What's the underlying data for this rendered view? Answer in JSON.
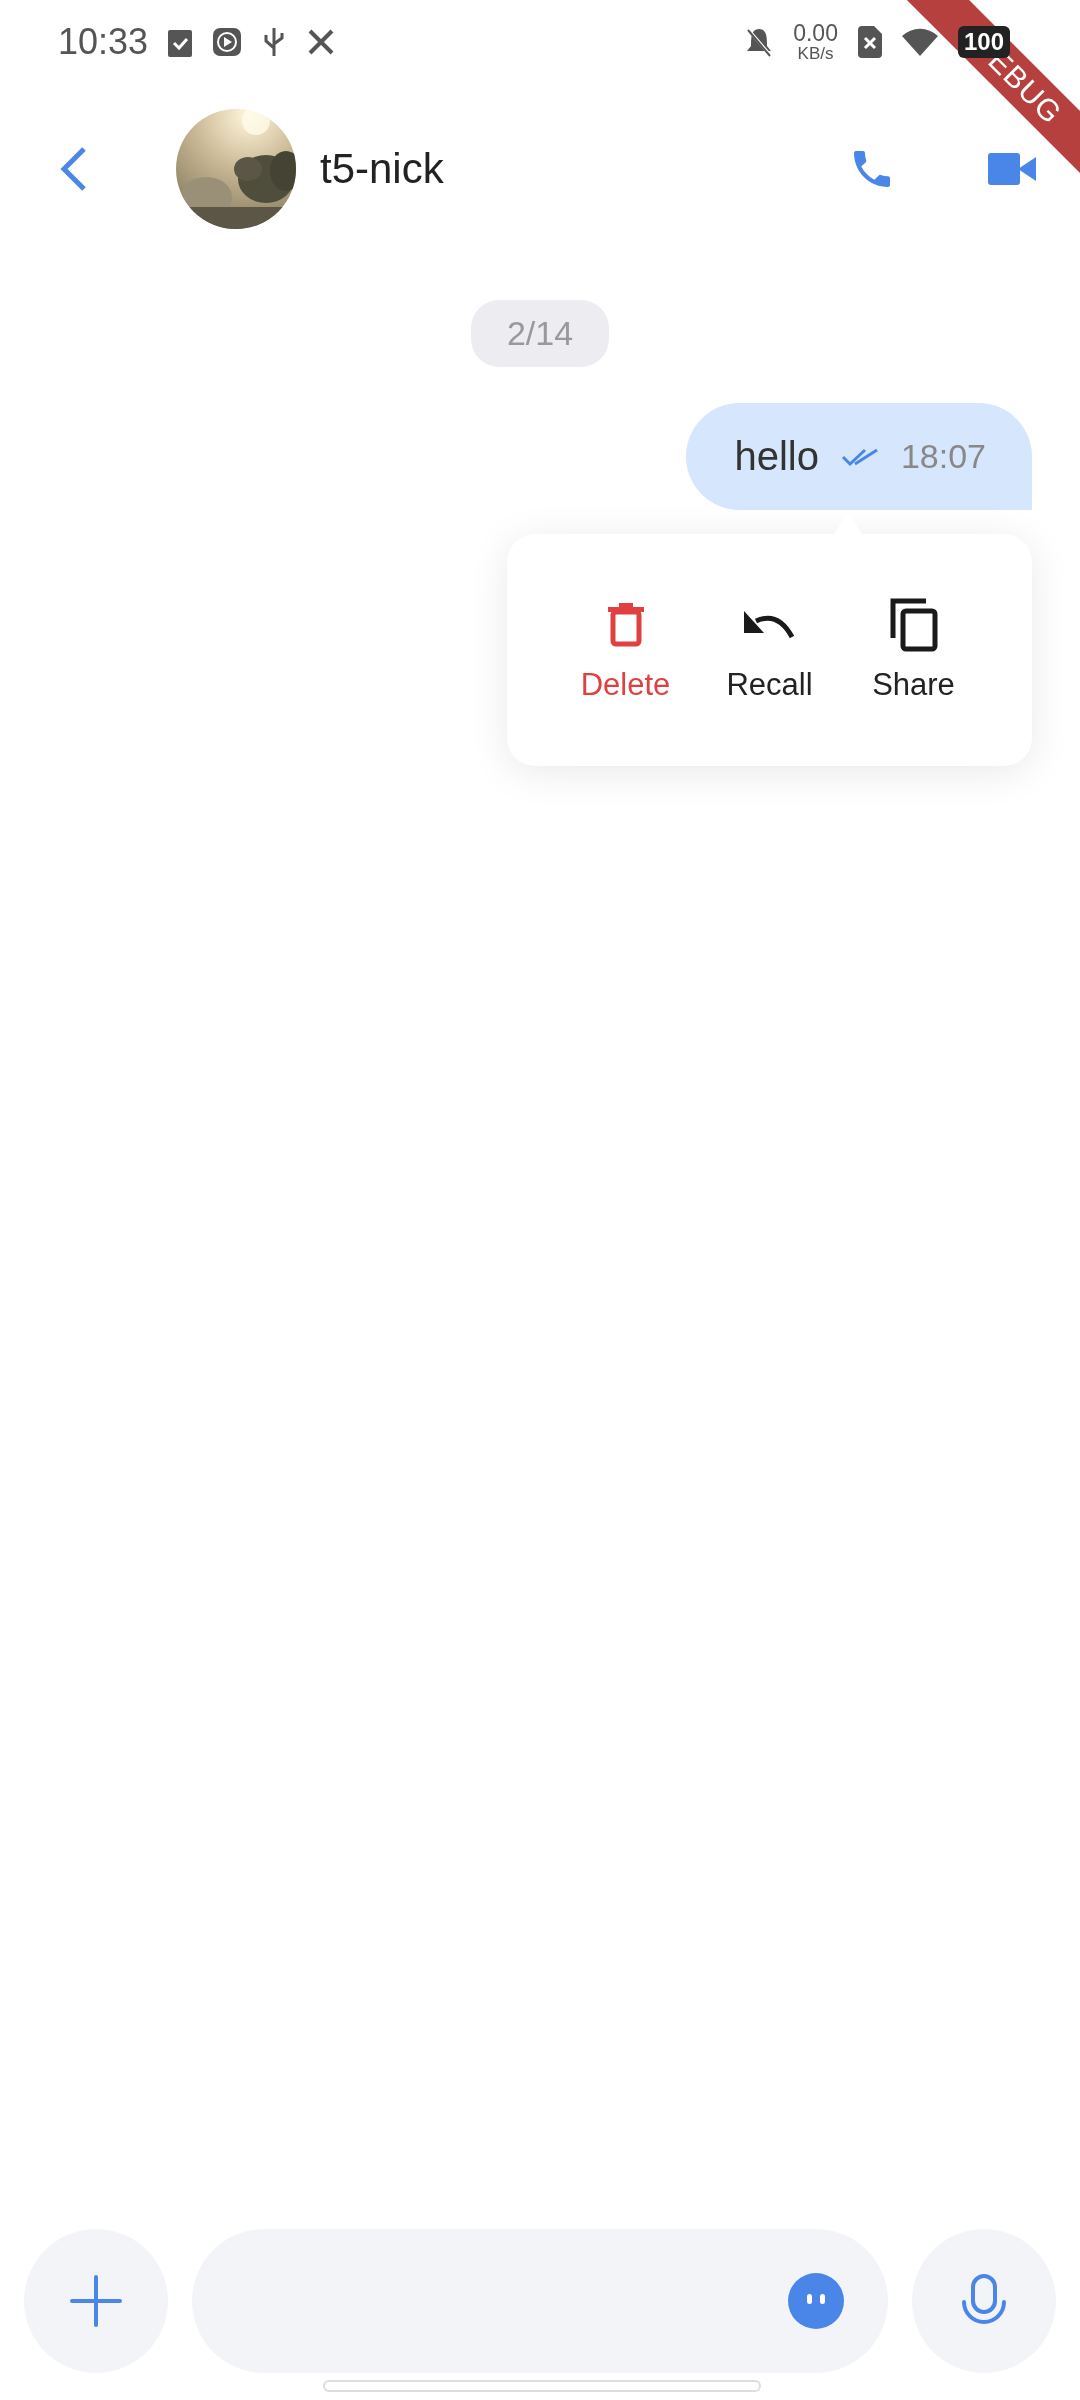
{
  "status_bar": {
    "time": "10:33",
    "net_speed": "0.00",
    "net_unit": "KB/s",
    "battery": "100"
  },
  "debug_ribbon": "EBUG",
  "header": {
    "contact_name": "t5-nick"
  },
  "date_chip": "2/14",
  "messages": [
    {
      "text": "hello",
      "time": "18:07",
      "read": true,
      "outgoing": true
    }
  ],
  "context_menu": [
    {
      "label": "Delete",
      "kind": "delete",
      "danger": true
    },
    {
      "label": "Recall",
      "kind": "recall",
      "danger": false
    },
    {
      "label": "Share",
      "kind": "share",
      "danger": false
    }
  ]
}
